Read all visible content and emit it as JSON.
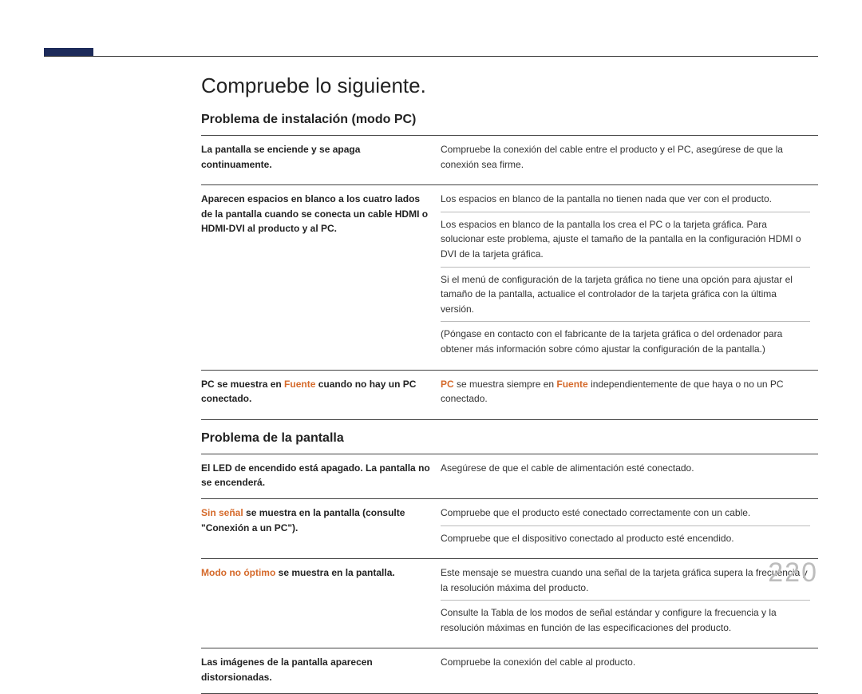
{
  "page_number": "220",
  "title": "Compruebe lo siguiente.",
  "sections": [
    {
      "heading": "Problema de instalación (modo PC)",
      "rows": [
        {
          "symptom_parts": [
            {
              "text": "La pantalla se enciende y se apaga continuamente."
            }
          ],
          "solutions": [
            "Compruebe la conexión del cable entre el producto y el PC, asegúrese de que la conexión sea firme."
          ]
        },
        {
          "symptom_parts": [
            {
              "text": "Aparecen espacios en blanco a los cuatro lados de la pantalla cuando se conecta un cable HDMI o HDMI-DVI al producto y al PC."
            }
          ],
          "solutions": [
            "Los espacios en blanco de la pantalla no tienen nada que ver con el producto.",
            "Los espacios en blanco de la pantalla los crea el PC o la tarjeta gráfica. Para solucionar este problema, ajuste el tamaño de la pantalla en la configuración HDMI o DVI de la tarjeta gráfica.",
            "Si el menú de configuración de la tarjeta gráfica no tiene una opción para ajustar el tamaño de la pantalla, actualice el controlador de la tarjeta gráfica con la última versión.",
            "(Póngase en contacto con el fabricante de la tarjeta gráfica o del ordenador para obtener más información sobre cómo ajustar la configuración de la pantalla.)"
          ]
        },
        {
          "symptom_parts": [
            {
              "text": "PC se muestra en "
            },
            {
              "text": "Fuente",
              "orange": true
            },
            {
              "text": " cuando no hay un PC conectado."
            }
          ],
          "solution_parts": [
            [
              {
                "text": "PC",
                "orange": true,
                "bold": true
              },
              {
                "text": " se muestra siempre en "
              },
              {
                "text": "Fuente",
                "orange": true,
                "bold": true
              },
              {
                "text": " independientemente de que haya o no un PC conectado."
              }
            ]
          ]
        }
      ]
    },
    {
      "heading": "Problema de la pantalla",
      "rows": [
        {
          "symptom_parts": [
            {
              "text": "El LED de encendido está apagado. La pantalla no se encenderá."
            }
          ],
          "solutions": [
            "Asegúrese de que el cable de alimentación esté conectado."
          ]
        },
        {
          "symptom_parts": [
            {
              "text": "Sin señal",
              "orange": true
            },
            {
              "text": " se muestra en la pantalla (consulte \"Conexión a un PC\")."
            }
          ],
          "solutions": [
            "Compruebe que el producto esté conectado correctamente con un cable.",
            "Compruebe que el dispositivo conectado al producto esté encendido."
          ]
        },
        {
          "symptom_parts": [
            {
              "text": "Modo no óptimo",
              "orange": true
            },
            {
              "text": " se muestra en la pantalla."
            }
          ],
          "solutions": [
            "Este mensaje se muestra cuando una señal de la tarjeta gráfica supera la frecuencia y la resolución máxima del producto.",
            "Consulte la Tabla de los modos de señal estándar y configure la frecuencia y la resolución máximas en función de las especificaciones del producto."
          ]
        },
        {
          "symptom_parts": [
            {
              "text": "Las imágenes de la pantalla aparecen distorsionadas."
            }
          ],
          "solutions": [
            "Compruebe la conexión del cable al producto."
          ]
        }
      ]
    }
  ]
}
